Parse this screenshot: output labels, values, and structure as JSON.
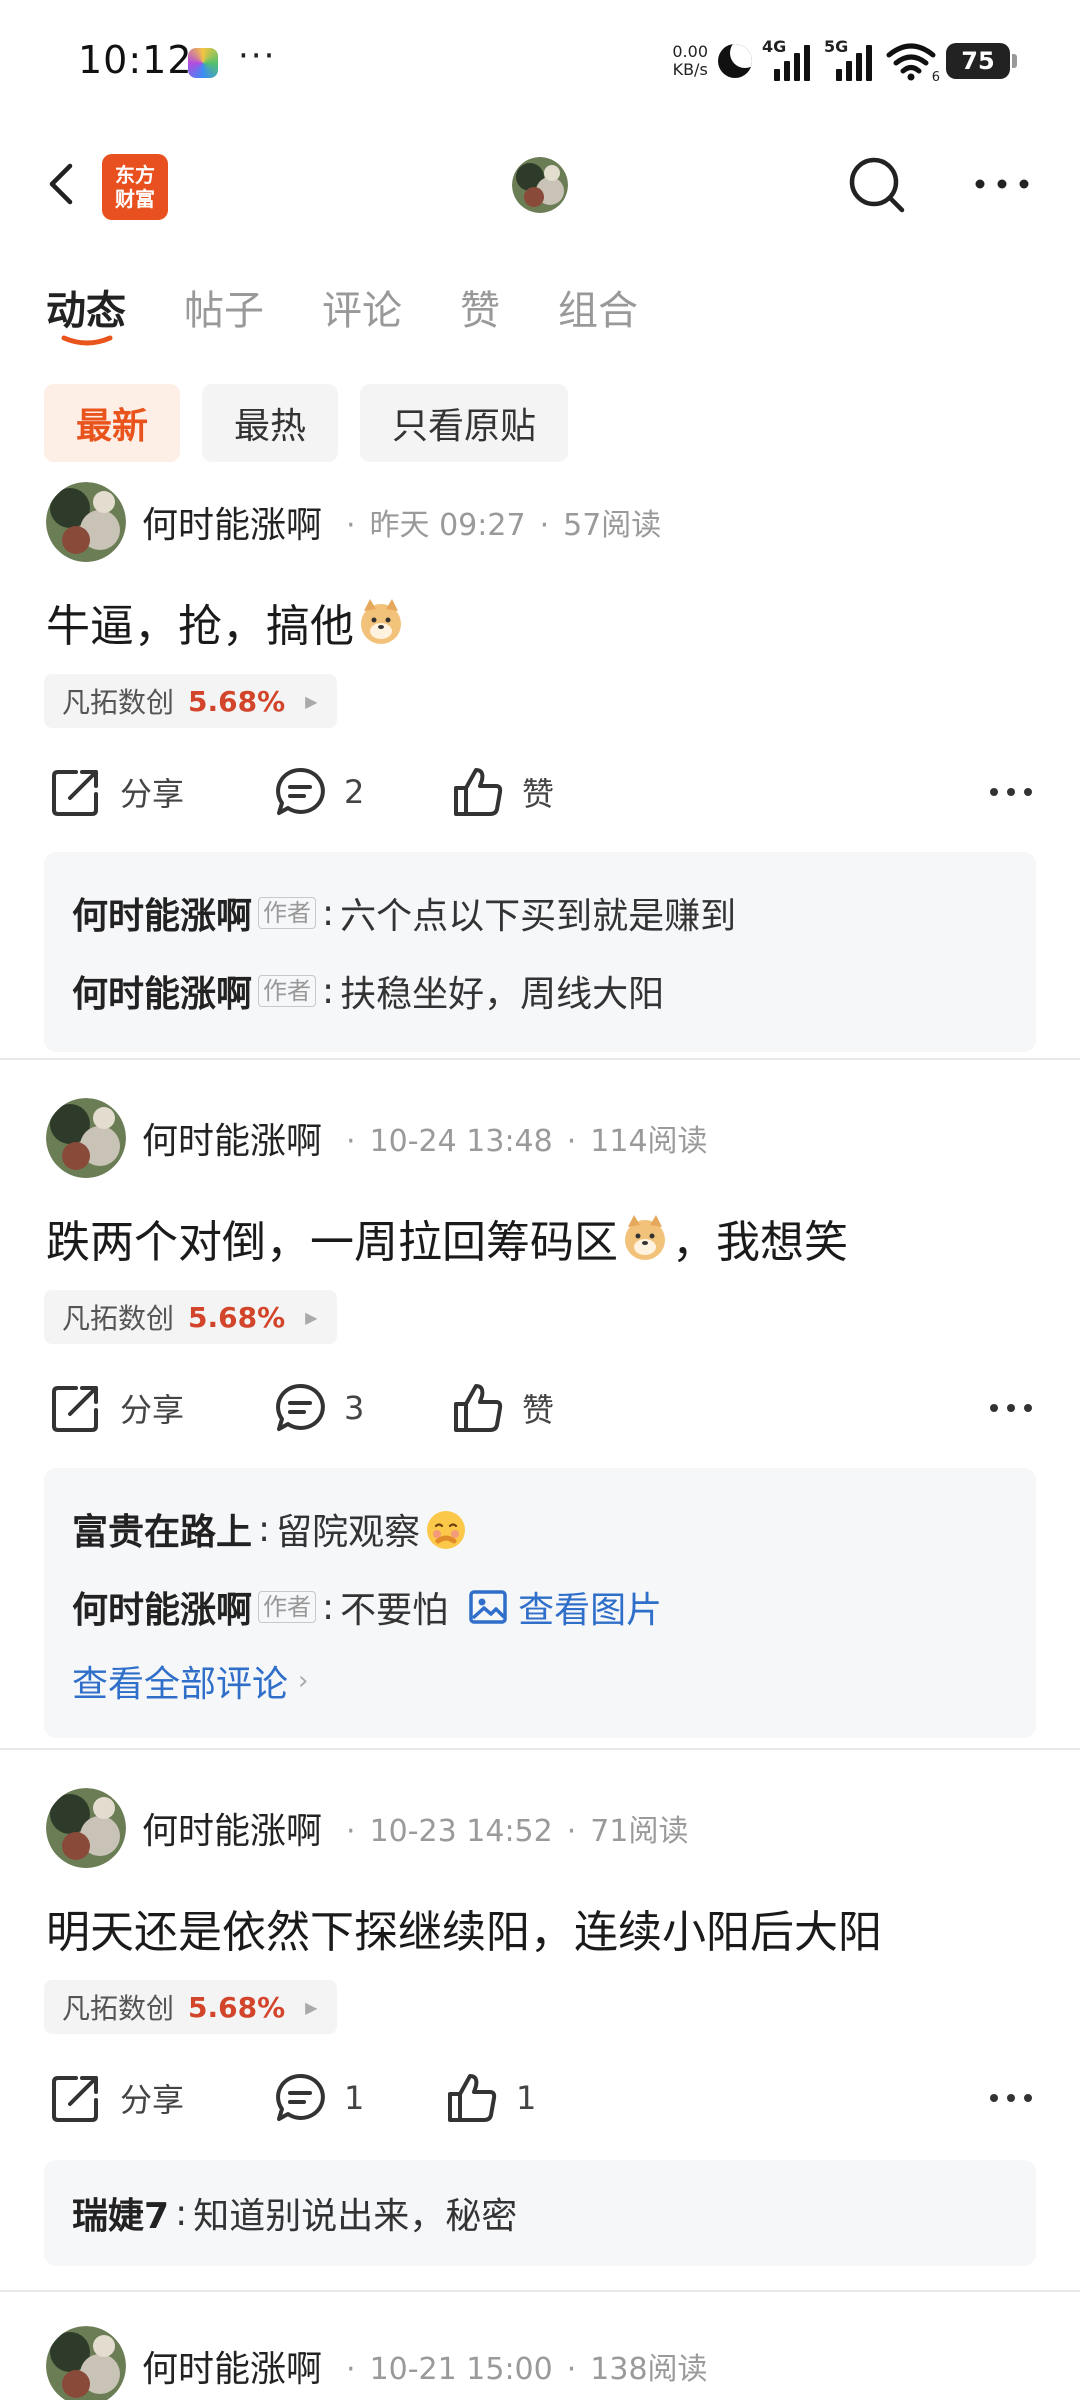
{
  "status_bar": {
    "time": "10:12",
    "more": "···",
    "net_speed_value": "0.00",
    "net_speed_unit": "KB/s",
    "signal1_label": "4G",
    "signal2_label": "5G",
    "wifi_sub": "6",
    "battery": "75"
  },
  "header": {
    "logo_line1": "东方",
    "logo_line2": "财富"
  },
  "tabs": [
    "动态",
    "帖子",
    "评论",
    "赞",
    "组合"
  ],
  "filters": [
    "最新",
    "最热",
    "只看原贴"
  ],
  "posts": [
    {
      "author": "何时能涨啊",
      "time": "昨天 09:27",
      "reads": "57阅读",
      "text_before": "牛逼，抢，搞他",
      "text_after": "",
      "stock_name": "凡拓数创",
      "stock_pct": "5.68%",
      "share_label": "分享",
      "comment_count": "2",
      "like_label": "赞",
      "comments": [
        {
          "name": "何时能涨啊",
          "badge": "作者",
          "text": "六个点以下买到就是赚到"
        },
        {
          "name": "何时能涨啊",
          "badge": "作者",
          "text": "扶稳坐好，周线大阳"
        }
      ]
    },
    {
      "author": "何时能涨啊",
      "time": "10-24 13:48",
      "reads": "114阅读",
      "text_before": "跌两个对倒，一周拉回筹码区",
      "text_after": "，我想笑",
      "stock_name": "凡拓数创",
      "stock_pct": "5.68%",
      "share_label": "分享",
      "comment_count": "3",
      "like_label": "赞",
      "comments": [
        {
          "name": "富贵在路上",
          "text": "留院观察"
        },
        {
          "name": "何时能涨啊",
          "badge": "作者",
          "text": "不要怕",
          "link": "查看图片"
        }
      ],
      "view_all": "查看全部评论"
    },
    {
      "author": "何时能涨啊",
      "time": "10-23 14:52",
      "reads": "71阅读",
      "text_before": "明天还是依然下探继续阳，连续小阳后大阳",
      "text_after": "",
      "stock_name": "凡拓数创",
      "stock_pct": "5.68%",
      "share_label": "分享",
      "comment_count": "1",
      "like_label": "1",
      "comments": [
        {
          "name": "瑞婕7",
          "text": "知道别说出来，秘密"
        }
      ]
    },
    {
      "author": "何时能涨啊",
      "time": "10-21 15:00",
      "reads": "138阅读"
    }
  ],
  "colors": {
    "accent": "#e9541d",
    "logo_bg": "#e8501f",
    "stock_up": "#d2452b",
    "link": "#2f6fc9"
  }
}
